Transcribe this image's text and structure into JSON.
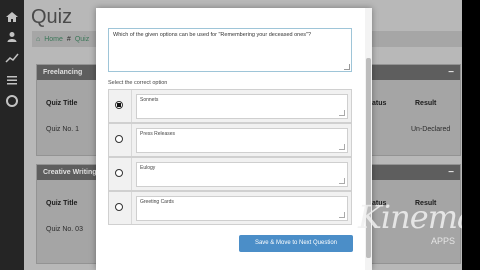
{
  "app": {
    "title": "Quiz",
    "breadcrumb": {
      "home": "Home",
      "sep": "#",
      "current": "Quiz"
    }
  },
  "cards": [
    {
      "header": "Freelancing",
      "columns": [
        "Quiz Title",
        "Status",
        "Result"
      ],
      "rows": [
        {
          "title": "Quiz No. 1",
          "result": "Un-Declared"
        }
      ]
    },
    {
      "header": "Creative Writing",
      "columns": [
        "Quiz Title",
        "Status",
        "Result"
      ],
      "rows": [
        {
          "title": "Quiz No. 03"
        }
      ]
    }
  ],
  "modal": {
    "question_text": "Which of the given options can be used for \"Remembering your deceased ones\"?",
    "select_label": "Select the correct option",
    "options": [
      {
        "label": "Sonnets",
        "selected": true
      },
      {
        "label": "Press Releases",
        "selected": false
      },
      {
        "label": "Eulogy",
        "selected": false
      },
      {
        "label": "Greeting Cards",
        "selected": false
      }
    ],
    "submit_label": "Save & Move to Next Question"
  },
  "watermark": {
    "main": "Kinemaster",
    "sub": "APPS"
  },
  "colors": {
    "sidebar": "#2b2b2b",
    "card_header": "#6b6b6b",
    "submit": "#4b8ec8"
  }
}
